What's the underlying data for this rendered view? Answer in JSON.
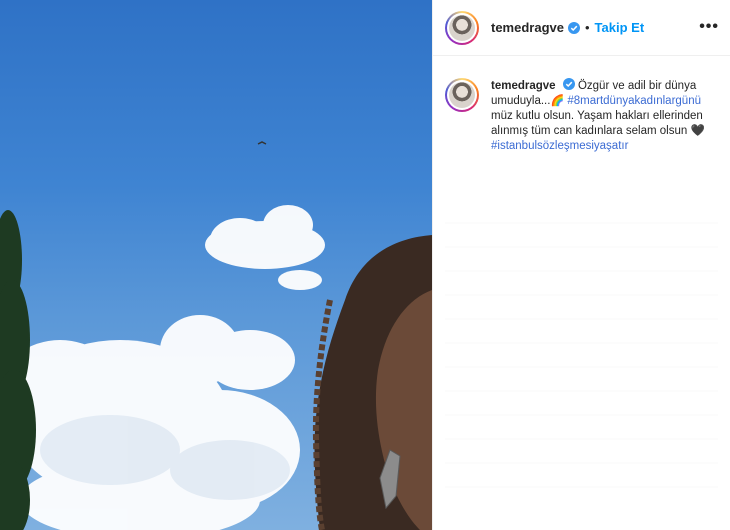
{
  "post": {
    "username": "temedragve",
    "follow_label": "Takip Et",
    "separator": "•",
    "more_label": "•••"
  },
  "caption": {
    "username": "temedragve",
    "text_1": "Özgür ve adil bir dünya umuduyla...",
    "emoji": "🌈",
    "hashtag_1": "#8martdünyakadınlargünü",
    "text_2": " müz kutlu olsun. Yaşam hakları ellerinden alınmış tüm can kadınlara selam olsun ",
    "heart": "🖤",
    "hashtag_2": "#istanbulsözleşmesiyaşatır"
  },
  "colors": {
    "link": "#0095f6",
    "hashtag": "#3b6bd3",
    "verified": "#3897f0"
  },
  "icons": {
    "verified": "verified-badge-icon",
    "more": "more-options-icon"
  }
}
